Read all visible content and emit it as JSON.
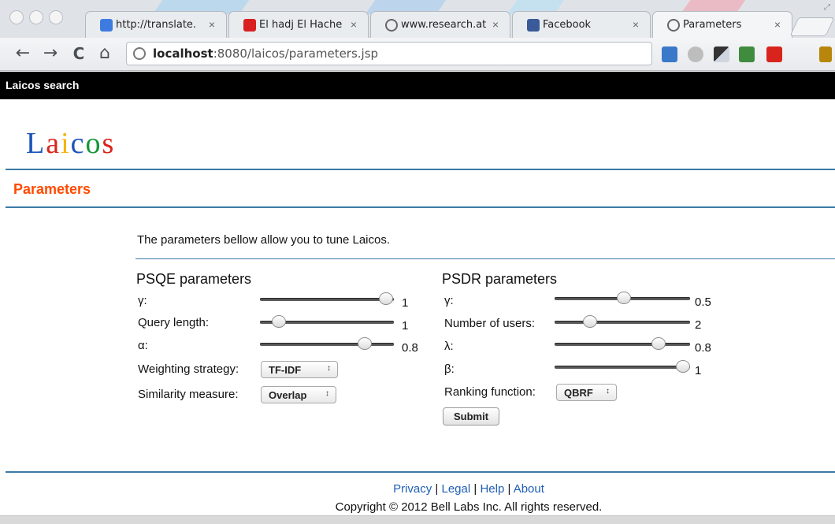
{
  "browser": {
    "tabs": [
      {
        "title": "http://translate.",
        "favicon": "translate-icon",
        "active": false
      },
      {
        "title": "El hadj El Hache",
        "favicon": "youtube-icon",
        "active": false
      },
      {
        "title": "www.research.at",
        "favicon": "globe-icon",
        "active": false
      },
      {
        "title": "Facebook",
        "favicon": "facebook-icon",
        "active": false
      },
      {
        "title": "Parameters",
        "favicon": "globe-icon",
        "active": true
      }
    ],
    "close_glyph": "×",
    "url_host": "localhost",
    "url_path": ":8080/laicos/parameters.jsp",
    "nav": {
      "back": "←",
      "forward": "→",
      "reload": "C",
      "home": "⌂"
    },
    "extension_icons": [
      "download-icon",
      "hand-icon",
      "window-icon",
      "translate-icon",
      "acrobat-icon",
      "wrench-icon"
    ]
  },
  "site_bar": {
    "title": "Laicos search"
  },
  "logo": {
    "letters": [
      "L",
      "a",
      "i",
      "c",
      "o",
      "s"
    ],
    "colors": [
      "#1a55b8",
      "#d8261c",
      "#f2b50f",
      "#1a55b8",
      "#17963b",
      "#d8261c"
    ]
  },
  "page": {
    "section_title": "Parameters",
    "intro": "The parameters bellow allow you to tune Laicos."
  },
  "psqe": {
    "title": "PSQE parameters",
    "gamma": {
      "label": "γ:",
      "value": "1",
      "fraction": 0.94
    },
    "query_length": {
      "label": "Query length:",
      "value": "1",
      "fraction": 0.14
    },
    "alpha": {
      "label": "α:",
      "value": "0.8",
      "fraction": 0.78
    },
    "weighting": {
      "label": "Weighting strategy:",
      "value": "TF-IDF"
    },
    "similarity": {
      "label": "Similarity measure:",
      "value": "Overlap"
    }
  },
  "psdr": {
    "title": "PSDR parameters",
    "gamma": {
      "label": "γ:",
      "value": "0.5",
      "fraction": 0.51
    },
    "num_users": {
      "label": "Number of users:",
      "value": "2",
      "fraction": 0.26
    },
    "lambda": {
      "label": "λ:",
      "value": "0.8",
      "fraction": 0.77
    },
    "beta": {
      "label": "β:",
      "value": "1",
      "fraction": 0.95
    },
    "ranking": {
      "label": "Ranking function:",
      "value": "QBRF"
    },
    "submit": "Submit"
  },
  "footer": {
    "privacy": "Privacy",
    "legal": "Legal",
    "help": "Help",
    "about": "About",
    "separator": " | ",
    "copyright": "Copyright © 2012 Bell Labs Inc. All rights reserved."
  },
  "colors": {
    "accent_rule": "#3b7ba6",
    "section_title": "#ff4a00",
    "link": "#1f5fb3"
  }
}
